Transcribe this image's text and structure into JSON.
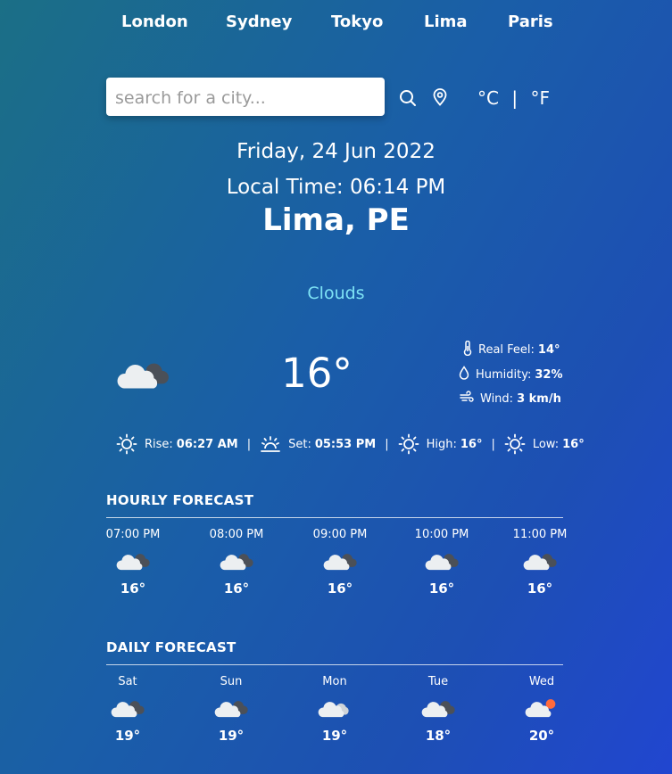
{
  "nav": {
    "cities": [
      "London",
      "Sydney",
      "Tokyo",
      "Lima",
      "Paris"
    ]
  },
  "search": {
    "placeholder": "search for a city...",
    "value": ""
  },
  "units": {
    "celsius": "°C",
    "separator": "|",
    "fahrenheit": "°F"
  },
  "header": {
    "date": "Friday, 24 Jun 2022",
    "local_time": "Local Time: 06:14 PM",
    "location": "Lima, PE"
  },
  "current": {
    "condition": "Clouds",
    "temperature": "16°",
    "icon": "cloud-icon",
    "real_feel_label": "Real Feel:",
    "real_feel": "14°",
    "humidity_label": "Humidity:",
    "humidity": "32%",
    "wind_label": "Wind:",
    "wind": "3 km/h"
  },
  "sun": {
    "rise_label": "Rise:",
    "rise": "06:27 AM",
    "set_label": "Set:",
    "set": "05:53 PM",
    "high_label": "High:",
    "high": "16°",
    "low_label": "Low:",
    "low": "16°",
    "separator": "|"
  },
  "hourly": {
    "title": "HOURLY FORECAST",
    "items": [
      {
        "label": "07:00 PM",
        "temp": "16°",
        "icon": "cloud-icon"
      },
      {
        "label": "08:00 PM",
        "temp": "16°",
        "icon": "cloud-icon"
      },
      {
        "label": "09:00 PM",
        "temp": "16°",
        "icon": "cloud-icon"
      },
      {
        "label": "10:00 PM",
        "temp": "16°",
        "icon": "cloud-icon"
      },
      {
        "label": "11:00 PM",
        "temp": "16°",
        "icon": "cloud-icon"
      }
    ]
  },
  "daily": {
    "title": "DAILY FORECAST",
    "items": [
      {
        "label": "Sat",
        "temp": "19°",
        "icon": "cloud-icon"
      },
      {
        "label": "Sun",
        "temp": "19°",
        "icon": "cloud-icon"
      },
      {
        "label": "Mon",
        "temp": "19°",
        "icon": "light-cloud-icon"
      },
      {
        "label": "Tue",
        "temp": "18°",
        "icon": "cloud-icon"
      },
      {
        "label": "Wed",
        "temp": "20°",
        "icon": "partly-cloudy-icon"
      }
    ]
  },
  "colors": {
    "condition_text": "#7ee3f5",
    "sun_accent": "#ff6a3d"
  }
}
